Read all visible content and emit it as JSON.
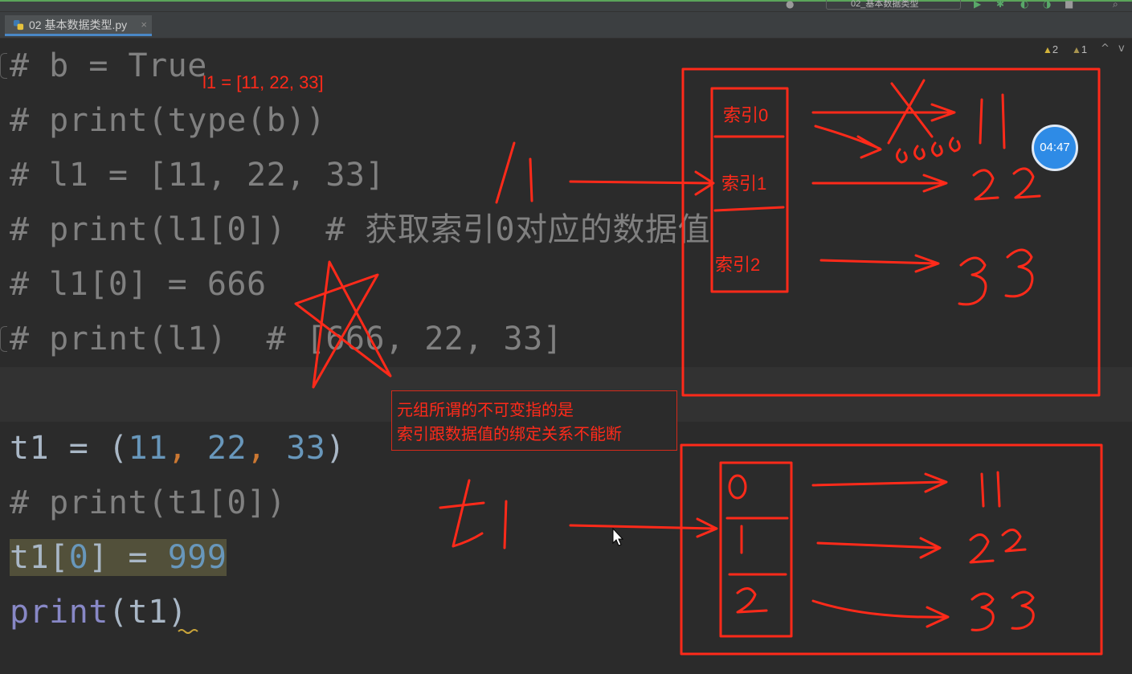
{
  "toolbar": {
    "run_config_label": "02_基本数据类型"
  },
  "tab": {
    "file_name": "02 基本数据类型.py",
    "close_glyph": "×"
  },
  "inspections": {
    "warnings": "2",
    "weak_warnings": "1",
    "up_glyph": "^",
    "down_glyph": "v"
  },
  "code_lines": {
    "l1": "# b = True",
    "l2": "# print(type(b))",
    "l3": "# l1 = [11, 22, 33]",
    "l4": "# print(l1[0])  # 获取索引0对应的数据值",
    "l5": "# l1[0] = 666",
    "l6": "# print(l1)  # [666, 22, 33]",
    "l8": {
      "name": "t1",
      "op": " = ",
      "open": "(",
      "n1": "11",
      "c1": ", ",
      "n2": "22",
      "c2": ", ",
      "n3": "33",
      "close": ")"
    },
    "l9": "# print(t1[0])",
    "l10": {
      "name": "t1",
      "open": "[",
      "idx": "0",
      "close": "]",
      "op": " = ",
      "val": "999"
    },
    "l11": {
      "fn": "print",
      "args": "(t1)"
    }
  },
  "annotations": {
    "list_label": "l1 = [11, 22, 33]",
    "index0": "索引0",
    "index1": "索引1",
    "index2": "索引2",
    "note_line1": "元组所谓的不可变指的是",
    "note_line2": "索引跟数据值的绑定关系不能断"
  },
  "timer": {
    "time": "04:47"
  },
  "colors": {
    "annotation_red": "#ff2a1a",
    "editor_bg": "#2b2b2b",
    "comment": "#808080",
    "number": "#6897bb",
    "builtin": "#8888c6"
  }
}
